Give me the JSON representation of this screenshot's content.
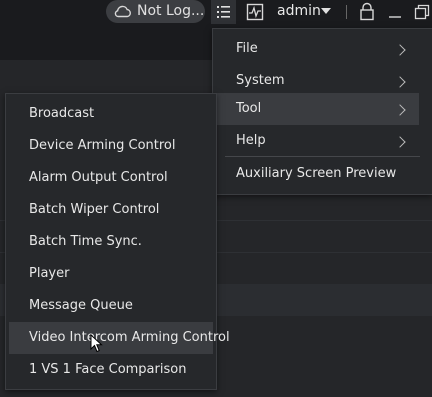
{
  "titlebar": {
    "cloud_status_label": "Not Log...",
    "user_label": "admin"
  },
  "main_menu": {
    "items": [
      {
        "label": "File",
        "has_submenu": true
      },
      {
        "label": "System",
        "has_submenu": true
      },
      {
        "label": "Tool",
        "has_submenu": true,
        "highlighted": true
      },
      {
        "label": "Help",
        "has_submenu": true
      },
      {
        "label": "Auxiliary Screen Preview",
        "has_submenu": false
      }
    ]
  },
  "tool_submenu": {
    "items": [
      {
        "label": "Broadcast"
      },
      {
        "label": "Device Arming Control"
      },
      {
        "label": "Alarm Output Control"
      },
      {
        "label": "Batch Wiper Control"
      },
      {
        "label": "Batch Time Sync."
      },
      {
        "label": "Player"
      },
      {
        "label": "Message Queue"
      },
      {
        "label": "Video Intercom Arming Control",
        "hovered": true
      },
      {
        "label": "1 VS 1 Face Comparison"
      }
    ]
  },
  "colors": {
    "background": "#252629",
    "titlebar": "#1a1b1e",
    "menu_bg": "#26282b",
    "highlight": "#3a3c40"
  }
}
